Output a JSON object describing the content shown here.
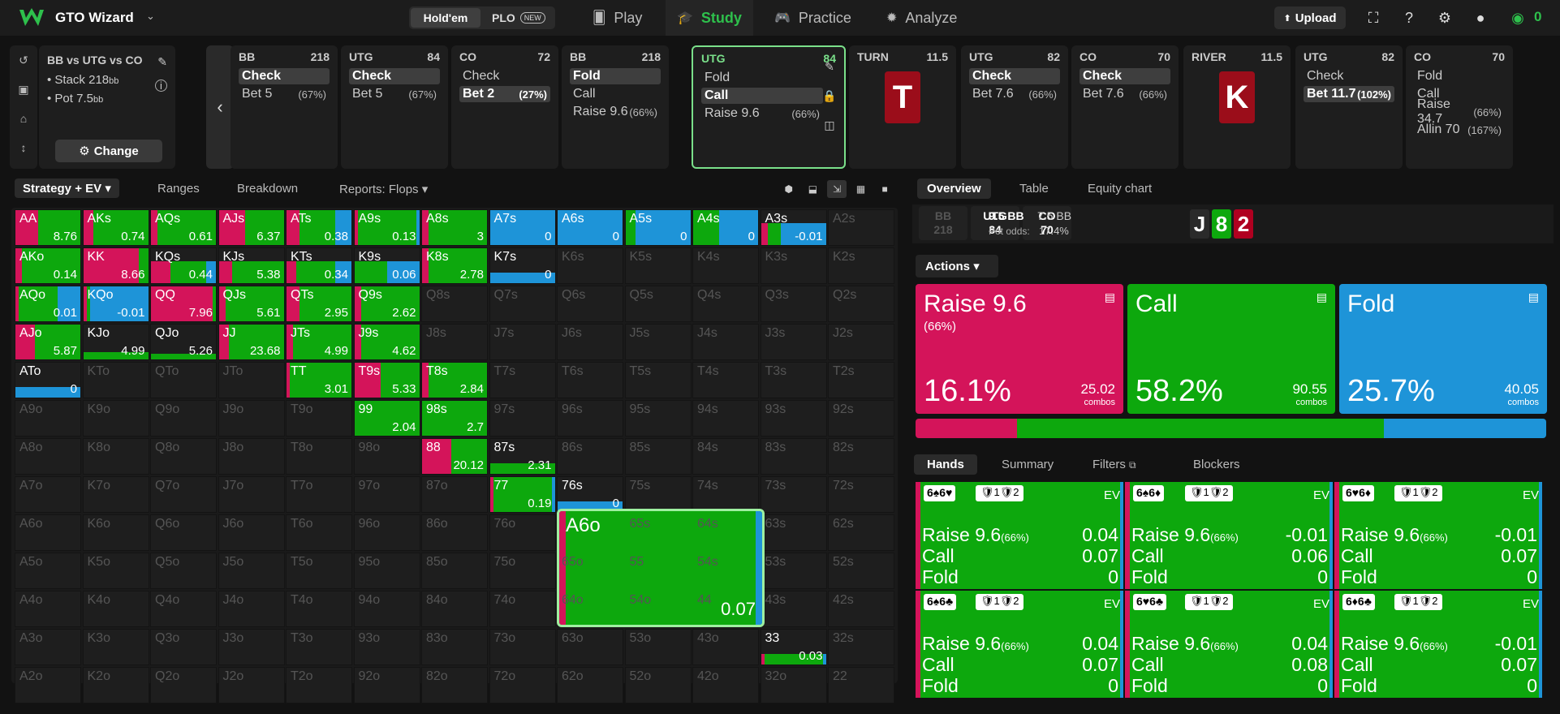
{
  "topbar": {
    "brand": "GTO Wizard",
    "holdem": "Hold'em",
    "plo": "PLO",
    "new_badge": "NEW",
    "nav": [
      "Play",
      "Study",
      "Practice",
      "Analyze"
    ],
    "upload": "Upload",
    "balance": "0"
  },
  "info": {
    "title": "BB vs UTG vs CO",
    "stack": "• Stack 218",
    "stack_unit": "bb",
    "pot": "• Pot 7.5",
    "pot_unit": "bb",
    "change": "Change"
  },
  "nodes": [
    {
      "pos": "BB",
      "stack": "218",
      "actions": [
        {
          "label": "Check",
          "pct": "",
          "sel": true
        },
        {
          "label": "Bet 5",
          "pct": "(67%)",
          "sel": false
        }
      ]
    },
    {
      "pos": "UTG",
      "stack": "84",
      "actions": [
        {
          "label": "Check",
          "pct": "",
          "sel": true
        },
        {
          "label": "Bet 5",
          "pct": "(67%)",
          "sel": false
        }
      ]
    },
    {
      "pos": "CO",
      "stack": "72",
      "actions": [
        {
          "label": "Check",
          "pct": "",
          "sel": false
        },
        {
          "label": "Bet 2",
          "pct": "(27%)",
          "sel": true
        }
      ]
    },
    {
      "pos": "BB",
      "stack": "218",
      "actions": [
        {
          "label": "Fold",
          "pct": "",
          "sel": true
        },
        {
          "label": "Call",
          "pct": "",
          "sel": false
        },
        {
          "label": "Raise 9.6",
          "pct": "(66%)",
          "sel": false
        }
      ]
    },
    {
      "pos": "UTG",
      "stack": "84",
      "active": true,
      "actions": [
        {
          "label": "Fold",
          "pct": "",
          "sel": false
        },
        {
          "label": "Call",
          "pct": "",
          "sel": true
        },
        {
          "label": "Raise 9.6",
          "pct": "(66%)",
          "sel": false
        }
      ]
    },
    {
      "pos": "TURN",
      "stack": "11.5",
      "card": "T"
    },
    {
      "pos": "UTG",
      "stack": "82",
      "actions": [
        {
          "label": "Check",
          "pct": "",
          "sel": true
        },
        {
          "label": "Bet 7.6",
          "pct": "(66%)",
          "sel": false
        }
      ]
    },
    {
      "pos": "CO",
      "stack": "70",
      "actions": [
        {
          "label": "Check",
          "pct": "",
          "sel": true
        },
        {
          "label": "Bet 7.6",
          "pct": "(66%)",
          "sel": false
        }
      ]
    },
    {
      "pos": "RIVER",
      "stack": "11.5",
      "card": "K"
    },
    {
      "pos": "UTG",
      "stack": "82",
      "actions": [
        {
          "label": "Check",
          "pct": "",
          "sel": false
        },
        {
          "label": "Bet 11.7",
          "pct": "(102%)",
          "sel": true
        }
      ]
    },
    {
      "pos": "CO",
      "stack": "70",
      "actions": [
        {
          "label": "Fold",
          "pct": "",
          "sel": false
        },
        {
          "label": "Call",
          "pct": "",
          "sel": false
        },
        {
          "label": "Raise 34.7",
          "pct": "(66%)",
          "sel": false
        },
        {
          "label": "Allin 70",
          "pct": "(167%)",
          "sel": false
        }
      ]
    }
  ],
  "strategy_tabs": [
    "Strategy + EV",
    "Ranges",
    "Breakdown",
    "Reports: Flops"
  ],
  "colors": {
    "raise": "#d4145a",
    "call": "#0da80d",
    "fold": "#1e94d8"
  },
  "grid_labels": [
    "AA",
    "AKs",
    "AQs",
    "AJs",
    "ATs",
    "A9s",
    "A8s",
    "A7s",
    "A6s",
    "A5s",
    "A4s",
    "A3s",
    "A2s",
    "AKo",
    "KK",
    "KQs",
    "KJs",
    "KTs",
    "K9s",
    "K8s",
    "K7s",
    "K6s",
    "K5s",
    "K4s",
    "K3s",
    "K2s",
    "AQo",
    "KQo",
    "QQ",
    "QJs",
    "QTs",
    "Q9s",
    "Q8s",
    "Q7s",
    "Q6s",
    "Q5s",
    "Q4s",
    "Q3s",
    "Q2s",
    "AJo",
    "KJo",
    "QJo",
    "JJ",
    "JTs",
    "J9s",
    "J8s",
    "J7s",
    "J6s",
    "J5s",
    "J4s",
    "J3s",
    "J2s",
    "ATo",
    "KTo",
    "QTo",
    "JTo",
    "TT",
    "T9s",
    "T8s",
    "T7s",
    "T6s",
    "T5s",
    "T4s",
    "T3s",
    "T2s",
    "A9o",
    "K9o",
    "Q9o",
    "J9o",
    "T9o",
    "99",
    "98s",
    "97s",
    "96s",
    "95s",
    "94s",
    "93s",
    "92s",
    "A8o",
    "K8o",
    "Q8o",
    "J8o",
    "T8o",
    "98o",
    "88",
    "87s",
    "86s",
    "85s",
    "84s",
    "83s",
    "82s",
    "A7o",
    "K7o",
    "Q7o",
    "J7o",
    "T7o",
    "97o",
    "87o",
    "77",
    "76s",
    "75s",
    "74s",
    "73s",
    "72s",
    "A6o",
    "K6o",
    "Q6o",
    "J6o",
    "T6o",
    "96o",
    "86o",
    "76o",
    "66",
    "65s",
    "64s",
    "63s",
    "62s",
    "A5o",
    "K5o",
    "Q5o",
    "J5o",
    "T5o",
    "95o",
    "85o",
    "75o",
    "65o",
    "55",
    "54s",
    "53s",
    "52s",
    "A4o",
    "K4o",
    "Q4o",
    "J4o",
    "T4o",
    "94o",
    "84o",
    "74o",
    "64o",
    "54o",
    "44",
    "43s",
    "42s",
    "A3o",
    "K3o",
    "Q3o",
    "J3o",
    "T3o",
    "93o",
    "83o",
    "73o",
    "63o",
    "53o",
    "43o",
    "33",
    "32s",
    "A2o",
    "K2o",
    "Q2o",
    "J2o",
    "T2o",
    "92o",
    "82o",
    "72o",
    "62o",
    "52o",
    "42o",
    "32o",
    "22"
  ],
  "grid_cells": {
    "AA": {
      "ev": "8.76",
      "r": 0.35,
      "c": 0.65,
      "f": 0,
      "h": 1
    },
    "AKs": {
      "ev": "0.74",
      "r": 0.15,
      "c": 0.85,
      "f": 0,
      "h": 1
    },
    "AQs": {
      "ev": "0.61",
      "r": 0.1,
      "c": 0.9,
      "f": 0,
      "h": 1
    },
    "AJs": {
      "ev": "6.37",
      "r": 0.4,
      "c": 0.6,
      "f": 0,
      "h": 1
    },
    "ATs": {
      "ev": "0.38",
      "r": 0.2,
      "c": 0.55,
      "f": 0.25,
      "h": 1
    },
    "A9s": {
      "ev": "0.13",
      "r": 0.05,
      "c": 0.9,
      "f": 0.05,
      "h": 1
    },
    "A8s": {
      "ev": "3",
      "r": 0.1,
      "c": 0.9,
      "f": 0,
      "h": 1
    },
    "A7s": {
      "ev": "0",
      "r": 0,
      "c": 0,
      "f": 1,
      "h": 1
    },
    "A6s": {
      "ev": "0",
      "r": 0,
      "c": 0,
      "f": 1,
      "h": 1
    },
    "A5s": {
      "ev": "0",
      "r": 0,
      "c": 0.15,
      "f": 0.85,
      "h": 1
    },
    "A4s": {
      "ev": "0",
      "r": 0,
      "c": 0.4,
      "f": 0.6,
      "h": 1
    },
    "A3s": {
      "ev": "-0.01",
      "r": 0.1,
      "c": 0.2,
      "f": 0.7,
      "h": 0.6
    },
    "AKo": {
      "ev": "0.14",
      "r": 0.1,
      "c": 0.9,
      "f": 0,
      "h": 1
    },
    "KK": {
      "ev": "8.66",
      "r": 0.85,
      "c": 0.15,
      "f": 0,
      "h": 1
    },
    "KQs": {
      "ev": "0.44",
      "r": 0.3,
      "c": 0.55,
      "f": 0.15,
      "h": 0.6
    },
    "KJs": {
      "ev": "5.38",
      "r": 0.2,
      "c": 0.8,
      "f": 0,
      "h": 0.6
    },
    "KTs": {
      "ev": "0.34",
      "r": 0.15,
      "c": 0.6,
      "f": 0.25,
      "h": 0.6
    },
    "K9s": {
      "ev": "0.06",
      "r": 0,
      "c": 0.5,
      "f": 0.5,
      "h": 0.6
    },
    "K8s": {
      "ev": "2.78",
      "r": 0.1,
      "c": 0.9,
      "f": 0,
      "h": 1
    },
    "K7s": {
      "ev": "0",
      "r": 0,
      "c": 0,
      "f": 1,
      "h": 0.3
    },
    "AQo": {
      "ev": "0.01",
      "r": 0.05,
      "c": 0.6,
      "f": 0.35,
      "h": 1
    },
    "KQo": {
      "ev": "-0.01",
      "r": 0.05,
      "c": 0.05,
      "f": 0.9,
      "h": 1
    },
    "QQ": {
      "ev": "7.96",
      "r": 0.95,
      "c": 0.05,
      "f": 0,
      "h": 1
    },
    "QJs": {
      "ev": "5.61",
      "r": 0.1,
      "c": 0.9,
      "f": 0,
      "h": 1
    },
    "QTs": {
      "ev": "2.95",
      "r": 0.2,
      "c": 0.8,
      "f": 0,
      "h": 1
    },
    "Q9s": {
      "ev": "2.62",
      "r": 0.1,
      "c": 0.9,
      "f": 0,
      "h": 1
    },
    "AJo": {
      "ev": "5.87",
      "r": 0.3,
      "c": 0.7,
      "f": 0,
      "h": 1
    },
    "KJo": {
      "ev": "4.99",
      "r": 0,
      "c": 1,
      "f": 0,
      "h": 0.2
    },
    "QJo": {
      "ev": "5.26",
      "r": 0,
      "c": 1,
      "f": 0,
      "h": 0.15
    },
    "JJ": {
      "ev": "23.68",
      "r": 0.15,
      "c": 0.85,
      "f": 0,
      "h": 1
    },
    "JTs": {
      "ev": "4.99",
      "r": 0.1,
      "c": 0.9,
      "f": 0,
      "h": 1
    },
    "J9s": {
      "ev": "4.62",
      "r": 0.1,
      "c": 0.9,
      "f": 0,
      "h": 1
    },
    "ATo": {
      "ev": "0",
      "r": 0,
      "c": 0,
      "f": 1,
      "h": 0.3
    },
    "TT": {
      "ev": "3.01",
      "r": 0.05,
      "c": 0.95,
      "f": 0,
      "h": 1
    },
    "T9s": {
      "ev": "5.33",
      "r": 0.4,
      "c": 0.6,
      "f": 0,
      "h": 1
    },
    "T8s": {
      "ev": "2.84",
      "r": 0.1,
      "c": 0.9,
      "f": 0,
      "h": 1
    },
    "99": {
      "ev": "2.04",
      "r": 0,
      "c": 1,
      "f": 0,
      "h": 1
    },
    "98s": {
      "ev": "2.7",
      "r": 0,
      "c": 1,
      "f": 0,
      "h": 1
    },
    "88": {
      "ev": "20.12",
      "r": 0.45,
      "c": 0.55,
      "f": 0,
      "h": 1
    },
    "87s": {
      "ev": "2.31",
      "r": 0,
      "c": 1,
      "f": 0,
      "h": 0.3
    },
    "77": {
      "ev": "0.19",
      "r": 0.05,
      "c": 0.9,
      "f": 0.05,
      "h": 1
    },
    "76s": {
      "ev": "0",
      "r": 0,
      "c": 0,
      "f": 1,
      "h": 0.3
    },
    "66": {
      "ev": "0.07",
      "r": 0.03,
      "c": 0.94,
      "f": 0.03,
      "h": 1,
      "big": true
    },
    "33": {
      "ev": "0.03",
      "r": 0.05,
      "c": 0.9,
      "f": 0.05,
      "h": 0.3
    }
  },
  "right_tabs": [
    "Overview",
    "Table",
    "Equity chart"
  ],
  "positions": [
    {
      "p": "BB",
      "v": "218",
      "dim": true
    },
    {
      "p": "UTG",
      "v": "84",
      "dim": false
    },
    {
      "p": "CO",
      "v": "70",
      "dim": false
    }
  ],
  "pot": {
    "bb": "9.5 BB",
    "bb2": "7.5 BB",
    "odds_label": "Pot odds:",
    "odds": "17.4%"
  },
  "board": [
    {
      "r": "J",
      "col": "#2a2a2a"
    },
    {
      "r": "8",
      "col": "#0da80d"
    },
    {
      "r": "2",
      "col": "#b00020"
    }
  ],
  "actions": {
    "header": "Actions",
    "boxes": [
      {
        "name": "Raise 9.6",
        "sub": "(66%)",
        "pct": "16.1%",
        "combos": "25.02",
        "combos_lbl": "combos",
        "freq": 0.161,
        "color": "#d4145a"
      },
      {
        "name": "Call",
        "sub": "",
        "pct": "58.2%",
        "combos": "90.55",
        "combos_lbl": "combos",
        "freq": 0.582,
        "color": "#0da80d"
      },
      {
        "name": "Fold",
        "sub": "",
        "pct": "25.7%",
        "combos": "40.05",
        "combos_lbl": "combos",
        "freq": 0.257,
        "color": "#1e94d8"
      }
    ]
  },
  "hand_tabs": [
    "Hands",
    "Summary",
    "Filters",
    "Blockers"
  ],
  "hands": [
    {
      "cards": "6♠6♥",
      "blk": "🛡1🛡2",
      "ev": "EV",
      "rows": [
        [
          "Raise 9.6",
          "(66%)",
          "0.04"
        ],
        [
          "Call",
          "",
          "0.07"
        ],
        [
          "Fold",
          "",
          "0"
        ]
      ]
    },
    {
      "cards": "6♠6♦",
      "blk": "🛡1🛡2",
      "ev": "EV",
      "rows": [
        [
          "Raise 9.6",
          "(66%)",
          "-0.01"
        ],
        [
          "Call",
          "",
          "0.06"
        ],
        [
          "Fold",
          "",
          "0"
        ]
      ]
    },
    {
      "cards": "6♥6♦",
      "blk": "🛡1🛡2",
      "ev": "EV",
      "rows": [
        [
          "Raise 9.6",
          "(66%)",
          "-0.01"
        ],
        [
          "Call",
          "",
          "0.07"
        ],
        [
          "Fold",
          "",
          "0"
        ]
      ]
    },
    {
      "cards": "6♠6♣",
      "blk": "🛡1🛡2",
      "ev": "EV",
      "rows": [
        [
          "Raise 9.6",
          "(66%)",
          "0.04"
        ],
        [
          "Call",
          "",
          "0.07"
        ],
        [
          "Fold",
          "",
          "0"
        ]
      ]
    },
    {
      "cards": "6♥6♣",
      "blk": "🛡1🛡2",
      "ev": "EV",
      "rows": [
        [
          "Raise 9.6",
          "(66%)",
          "0.04"
        ],
        [
          "Call",
          "",
          "0.08"
        ],
        [
          "Fold",
          "",
          "0"
        ]
      ]
    },
    {
      "cards": "6♦6♣",
      "blk": "🛡1🛡2",
      "ev": "EV",
      "rows": [
        [
          "Raise 9.6",
          "(66%)",
          "-0.01"
        ],
        [
          "Call",
          "",
          "0.07"
        ],
        [
          "Fold",
          "",
          "0"
        ]
      ]
    }
  ]
}
